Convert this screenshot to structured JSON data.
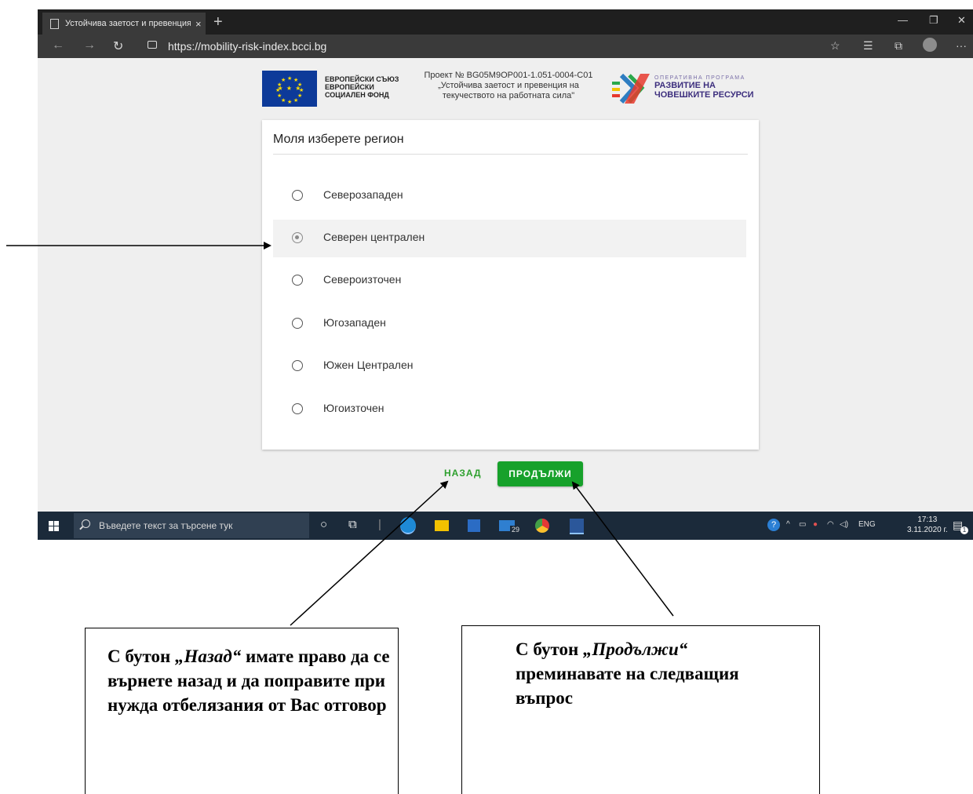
{
  "browser": {
    "tab_title": "Устойчива заетост и превенция",
    "tab_close": "×",
    "new_tab": "+",
    "url": "https://mobility-risk-index.bcci.bg"
  },
  "header": {
    "eu_lines": [
      "ЕВРОПЕЙСКИ СЪЮЗ",
      "ЕВРОПЕЙСКИ",
      "СОЦИАЛЕН ФОНД"
    ],
    "project_lines": [
      "Проект № BG05M9OP001-1.051-0004-C01",
      "„Устойчива заетост и превенция на",
      "текучеството на работната сила\""
    ],
    "op_small": "ОПЕРАТИВНА ПРОГРАМА",
    "op_big_lines": [
      "РАЗВИТИЕ НА",
      "ЧОВЕШКИТЕ РЕСУРСИ"
    ]
  },
  "form": {
    "title": "Моля изберете регион",
    "selected_index": 1,
    "options": [
      {
        "label": "Северозападен"
      },
      {
        "label": "Северен централен"
      },
      {
        "label": "Североизточен"
      },
      {
        "label": "Югозападен"
      },
      {
        "label": "Южен Централен"
      },
      {
        "label": "Югоизточен"
      }
    ]
  },
  "buttons": {
    "back": "НАЗАД",
    "next": "ПРОДЪЛЖИ"
  },
  "taskbar": {
    "search_placeholder": "Въведете текст за търсене тук",
    "mail_badge": "29",
    "lang": "ENG",
    "time": "17:13",
    "date": "3.11.2020 г.",
    "notification_count": "1"
  },
  "annotations": {
    "back_note": {
      "prefix": "С бутон ",
      "button": "„Назад“",
      "rest": " имате право да се върнете назад и да поправите при нужда отбелязания от Вас отговор"
    },
    "next_note": {
      "prefix": "С бутон ",
      "button": "„Продължи“",
      "rest": " преминавате на следващия въпрос"
    }
  },
  "colors": {
    "accent_green": "#17a12b",
    "back_green": "#2ea02e",
    "taskbar": "#1b2a3a",
    "eu_blue": "#0d3a99"
  }
}
